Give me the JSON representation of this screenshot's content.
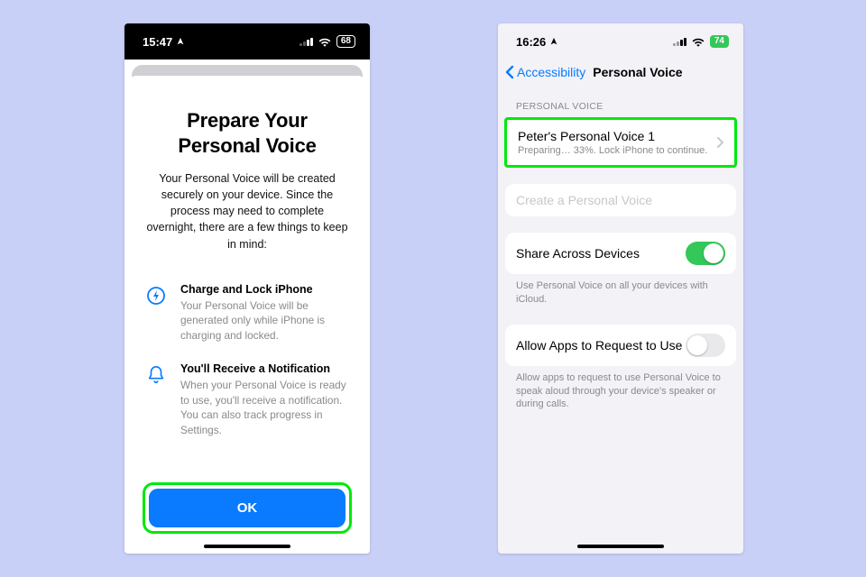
{
  "left": {
    "status": {
      "time": "15:47",
      "battery": "68"
    },
    "title_line1": "Prepare Your",
    "title_line2": "Personal Voice",
    "body": "Your Personal Voice will be created securely on your device. Since the process may need to complete overnight, there are a few things to keep in mind:",
    "item1": {
      "heading": "Charge and Lock iPhone",
      "desc": "Your Personal Voice will be generated only while iPhone is charging and locked."
    },
    "item2": {
      "heading": "You'll Receive a Notification",
      "desc": "When your Personal Voice is ready to use, you'll receive a notification. You can also track progress in Settings."
    },
    "ok_label": "OK"
  },
  "right": {
    "status": {
      "time": "16:26",
      "battery": "74"
    },
    "nav": {
      "back": "Accessibility",
      "title": "Personal Voice"
    },
    "section_header": "PERSONAL VOICE",
    "voice_row": {
      "title": "Peter's Personal Voice 1",
      "sub": "Preparing… 33%. Lock iPhone to continue."
    },
    "create_label": "Create a Personal Voice",
    "share": {
      "label": "Share Across Devices",
      "footer": "Use Personal Voice on all your devices with iCloud."
    },
    "allow": {
      "label": "Allow Apps to Request to Use",
      "footer": "Allow apps to request to use Personal Voice to speak aloud through your device's speaker or during calls."
    }
  }
}
